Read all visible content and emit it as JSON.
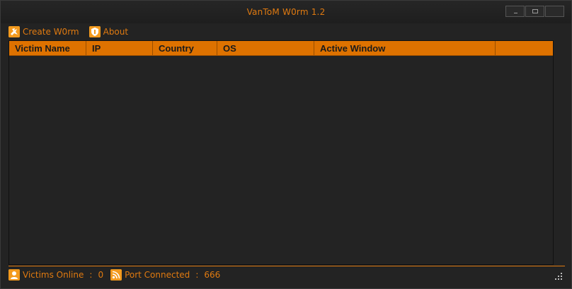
{
  "window": {
    "title": "VanToM W0rm 1.2",
    "controls": [
      "minimize",
      "maximize",
      "close"
    ]
  },
  "toolbar": {
    "items": [
      {
        "label": "Create W0rm",
        "icon": "worm-icon"
      },
      {
        "label": "About",
        "icon": "shield-icon"
      }
    ]
  },
  "grid": {
    "columns": [
      {
        "label": "Victim Name"
      },
      {
        "label": "IP"
      },
      {
        "label": "Country"
      },
      {
        "label": "OS"
      },
      {
        "label": "Active Window"
      },
      {
        "label": ""
      }
    ],
    "rows": []
  },
  "status": {
    "victims_label": "Victims Online",
    "separator1": ":",
    "victims_value": "0",
    "port_label": "Port Connected",
    "separator2": ":",
    "port_value": "666"
  },
  "colors": {
    "accent": "#de7200",
    "text_accent": "#e07a10",
    "background": "#232323",
    "titlebar": "#1e1e1e"
  }
}
